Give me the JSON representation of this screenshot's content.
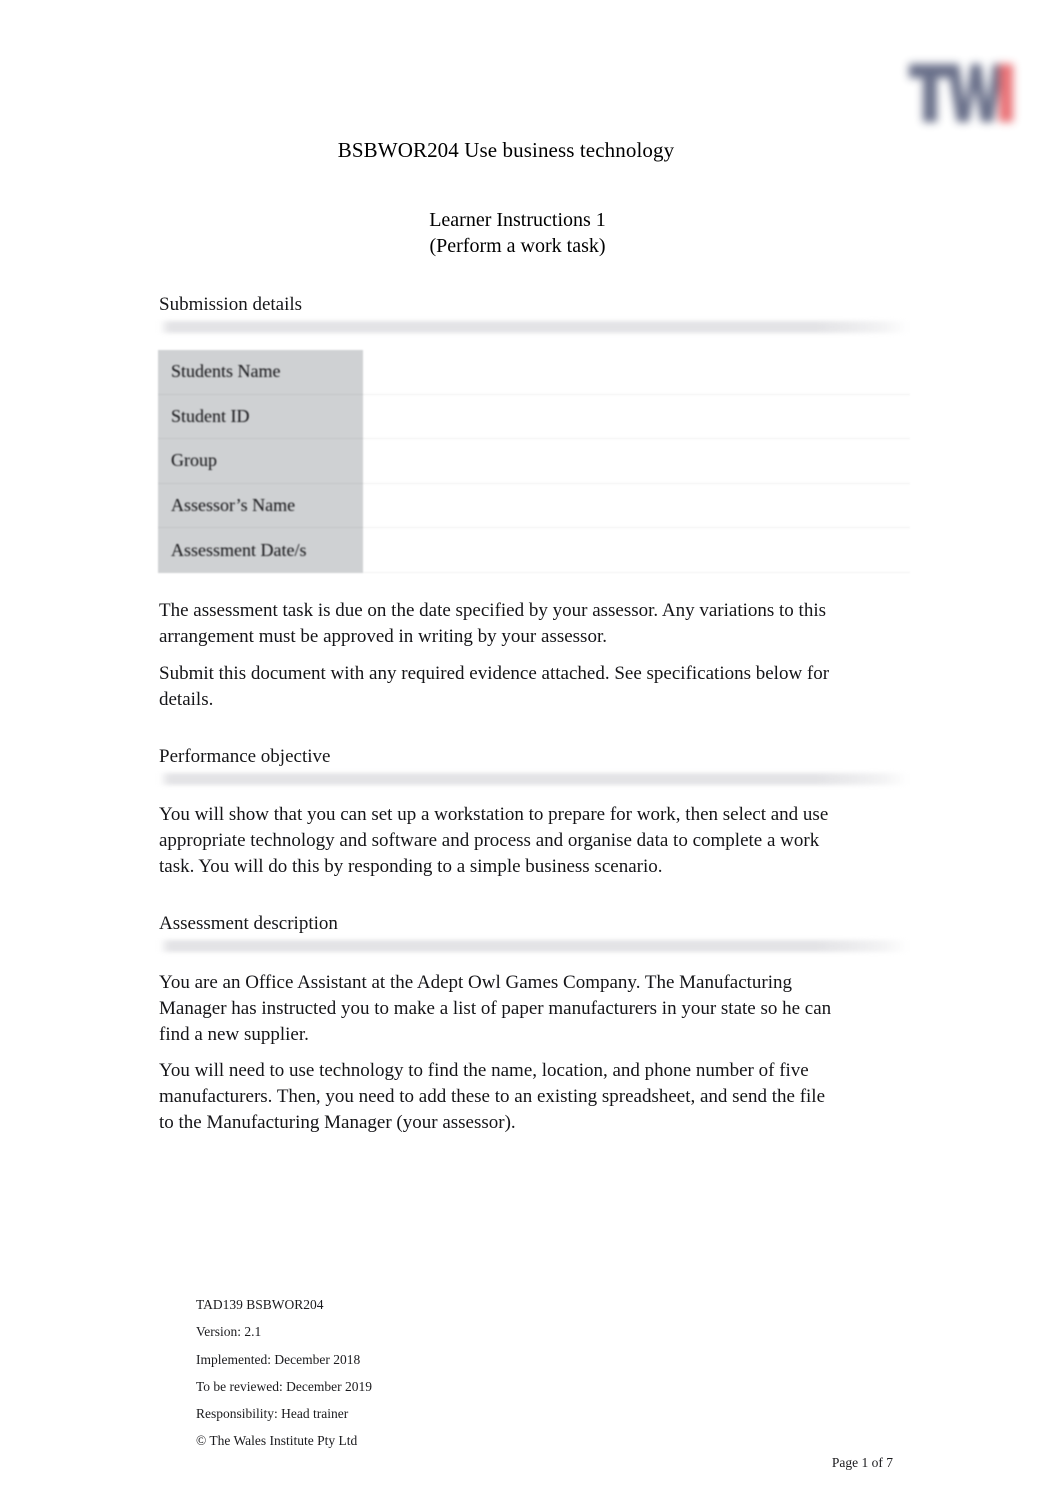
{
  "document": {
    "title": "BSBWOR204 Use business technology",
    "subtitle_line1": "Learner Instructions 1",
    "subtitle_line2": "(Perform a work task)"
  },
  "logo": {
    "name": "twi-logo",
    "primary_color": "#5d6480",
    "accent_color": "#e8656a"
  },
  "sections": {
    "submission": {
      "heading": "Submission details",
      "table": {
        "rows": [
          {
            "label": "Students Name",
            "value": ""
          },
          {
            "label": "Student ID",
            "value": ""
          },
          {
            "label": "Group",
            "value": ""
          },
          {
            "label": "Assessor’s Name",
            "value": ""
          },
          {
            "label": "Assessment Date/s",
            "value": ""
          }
        ]
      },
      "paragraph1": "The assessment task is due on the date specified by your assessor. Any variations to this arrangement must be approved in writing by your assessor.",
      "paragraph2": "Submit this document with any required evidence attached. See specifications below for details."
    },
    "performance_objective": {
      "heading": "Performance objective",
      "paragraph1": "You will show that you can set up a workstation to prepare for work, then select and use appropriate technology and software and process and organise data to complete a work task. You will do this by responding to a simple business scenario."
    },
    "assessment_description": {
      "heading": "Assessment description",
      "paragraph1": "You are an Office Assistant at the Adept Owl Games Company. The Manufacturing Manager has instructed you to make a list of paper manufacturers in your state so he can find a new supplier.",
      "paragraph2": "You will need to use technology to find the name, location, and phone number of five manufacturers. Then, you need to add these to an existing spreadsheet, and send the file to the Manufacturing Manager (your assessor)."
    }
  },
  "footer": {
    "code": "TAD139 BSBWOR204",
    "version": "Version: 2.1",
    "implemented": "Implemented: December 2018",
    "to_be_reviewed": "To be reviewed: December 2019",
    "responsibility": "Responsibility: Head trainer",
    "copyright": "© The Wales Institute Pty Ltd",
    "page_number": "Page 1 of 7"
  }
}
